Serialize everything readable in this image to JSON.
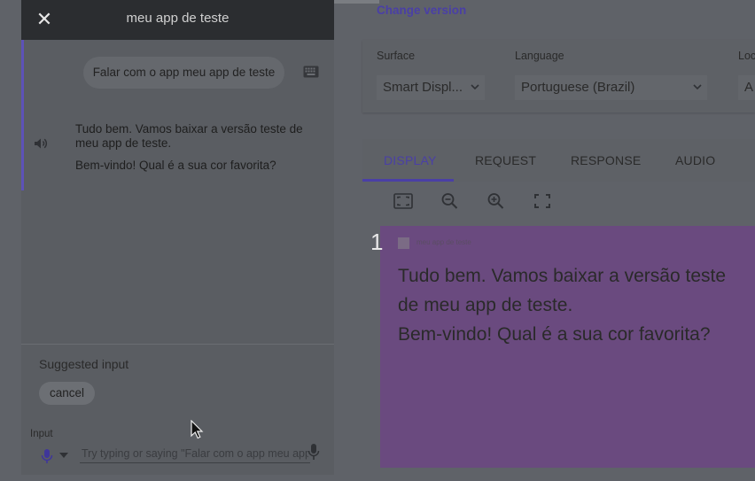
{
  "simulator": {
    "app_title": "meu app de teste",
    "user_query": "Falar com o app meu app de teste",
    "reply_line1": "Tudo bem. Vamos baixar a versão teste de meu app de teste.",
    "reply_line2": "Bem-vindo! Qual é a sua cor favorita?",
    "suggested_label": "Suggested input",
    "suggestion_chip": "cancel",
    "input_label": "Input",
    "input_placeholder": "Try typing or saying \"Falar com o app meu app de teste\""
  },
  "header": {
    "change_version": "Change version"
  },
  "settings": {
    "surface_label": "Surface",
    "surface_value": "Smart Displ...",
    "language_label": "Language",
    "language_value": "Portuguese (Brazil)",
    "location_label": "Loc",
    "location_value": "A"
  },
  "tabs": {
    "display": "DISPLAY",
    "request": "REQUEST",
    "response": "RESPONSE",
    "audio": "AUDIO"
  },
  "device": {
    "number": "1",
    "mini_app_name": "meu app de teste",
    "line1": "Tudo bem. Vamos baixar a versão teste",
    "line2": "de meu app de teste.",
    "line3": "Bem-vindo! Qual é a sua cor favorita?"
  },
  "icons": [
    "close-icon",
    "keyboard-icon",
    "speaker-icon",
    "mic-icon",
    "caret-down-icon",
    "fit-screen-icon",
    "zoom-out-icon",
    "zoom-in-icon",
    "fullscreen-icon"
  ],
  "colors": {
    "accent": "#4a3fa6",
    "device_bg": "#6a4a7f",
    "overlay": "#5f6268"
  }
}
